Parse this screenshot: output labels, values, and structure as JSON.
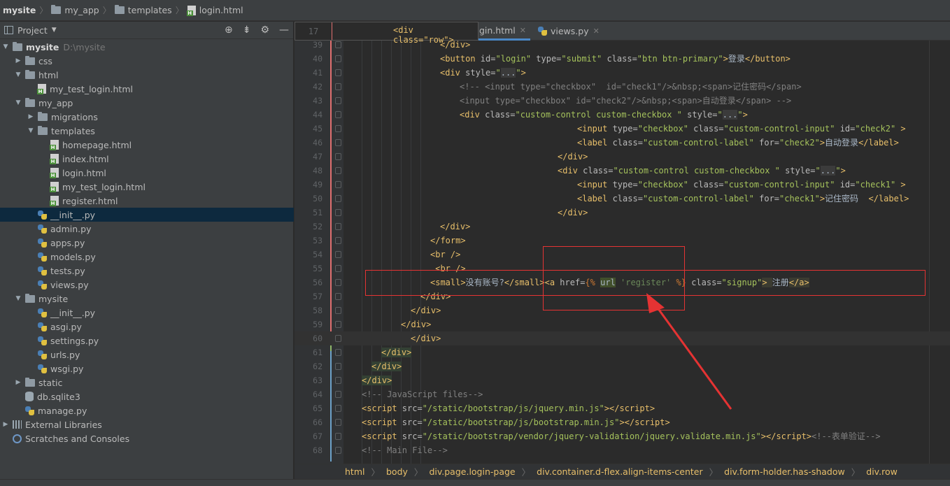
{
  "breadcrumb": {
    "items": [
      "mysite",
      "my_app",
      "templates",
      "login.html"
    ]
  },
  "project_panel": {
    "title": "Project",
    "tree": [
      {
        "label": "mysite",
        "hint": "D:\\mysite",
        "type": "folder",
        "level": 0,
        "expanded": true,
        "bold": true
      },
      {
        "label": "css",
        "type": "folder",
        "level": 1,
        "expanded": false
      },
      {
        "label": "html",
        "type": "folder",
        "level": 1,
        "expanded": true
      },
      {
        "label": "my_test_login.html",
        "type": "html",
        "level": 2
      },
      {
        "label": "my_app",
        "type": "folder",
        "level": 1,
        "expanded": true
      },
      {
        "label": "migrations",
        "type": "folder",
        "level": 2,
        "expanded": false
      },
      {
        "label": "templates",
        "type": "folder",
        "level": 2,
        "expanded": true
      },
      {
        "label": "homepage.html",
        "type": "html",
        "level": 3
      },
      {
        "label": "index.html",
        "type": "html",
        "level": 3
      },
      {
        "label": "login.html",
        "type": "html",
        "level": 3
      },
      {
        "label": "my_test_login.html",
        "type": "html",
        "level": 3
      },
      {
        "label": "register.html",
        "type": "html",
        "level": 3
      },
      {
        "label": "__init__.py",
        "type": "py",
        "level": 2,
        "selected": true
      },
      {
        "label": "admin.py",
        "type": "py",
        "level": 2
      },
      {
        "label": "apps.py",
        "type": "py",
        "level": 2
      },
      {
        "label": "models.py",
        "type": "py",
        "level": 2
      },
      {
        "label": "tests.py",
        "type": "py",
        "level": 2
      },
      {
        "label": "views.py",
        "type": "py",
        "level": 2
      },
      {
        "label": "mysite",
        "type": "folder",
        "level": 1,
        "expanded": true
      },
      {
        "label": "__init__.py",
        "type": "py",
        "level": 2
      },
      {
        "label": "asgi.py",
        "type": "py",
        "level": 2
      },
      {
        "label": "settings.py",
        "type": "py",
        "level": 2
      },
      {
        "label": "urls.py",
        "type": "py",
        "level": 2
      },
      {
        "label": "wsgi.py",
        "type": "py",
        "level": 2
      },
      {
        "label": "static",
        "type": "folder",
        "level": 1,
        "expanded": false
      },
      {
        "label": "db.sqlite3",
        "type": "db",
        "level": 1
      },
      {
        "label": "manage.py",
        "type": "py",
        "level": 1
      },
      {
        "label": "External Libraries",
        "type": "lib",
        "level": 0,
        "expanded": false
      },
      {
        "label": "Scratches and Consoles",
        "type": "scratch",
        "level": 0
      }
    ]
  },
  "tabs": [
    {
      "label": "login.html",
      "visible_text": "gin.html",
      "active": true
    },
    {
      "label": "views.py",
      "visible_text": "views.py",
      "active": false
    }
  ],
  "sticky_header": {
    "line": "17",
    "code": "<div class=\"row\">"
  },
  "code_lines": [
    {
      "n": "39",
      "html": "<span class=\"tg\">&lt;/div&gt;</span>",
      "indent": 112
    },
    {
      "n": "40",
      "html": "<span class=\"tg\">&lt;button </span><span class=\"at\">id=</span><span class=\"av\">\"login\"</span><span class=\"at\"> type=</span><span class=\"av\">\"submit\"</span><span class=\"at\"> class=</span><span class=\"av\">\"btn btn-primary\"</span><span class=\"tg\">&gt;</span><span class=\"tx\">登录</span><span class=\"tg\">&lt;/button&gt;</span>",
      "indent": 112
    },
    {
      "n": "41",
      "html": "<span class=\"tg\">&lt;div </span><span class=\"at\">style=</span><span class=\"av\">\"<span class=\"fold-ph\">...</span>\"</span><span class=\"tg\">&gt;</span>",
      "indent": 112
    },
    {
      "n": "42",
      "html": "<span class=\"cm\">&lt;!-- &lt;input type=\"checkbox\"  id=\"check1\"/&gt;&amp;nbsp;&lt;span&gt;记住密码&lt;/span&gt;</span>",
      "indent": 140
    },
    {
      "n": "43",
      "html": "<span class=\"cm\">&lt;input type=\"checkbox\" id=\"check2\"/&gt;&amp;nbsp;&lt;span&gt;自动登录&lt;/span&gt; --&gt;</span>",
      "indent": 140
    },
    {
      "n": "44",
      "html": "<span class=\"tg\">&lt;div </span><span class=\"at\">class=</span><span class=\"av\">\"custom-control custom-checkbox \"</span><span class=\"at\"> style=</span><span class=\"av\">\"<span class=\"fold-ph\">...</span>\"</span><span class=\"tg\">&gt;</span>",
      "indent": 140
    },
    {
      "n": "45",
      "html": "<span class=\"tg\">&lt;input </span><span class=\"at\">type=</span><span class=\"av\">\"checkbox\"</span><span class=\"at\"> class=</span><span class=\"av\">\"custom-control-input\"</span><span class=\"at\"> id=</span><span class=\"av\">\"check2\"</span><span class=\"tg\"> &gt;</span>",
      "indent": 308
    },
    {
      "n": "46",
      "html": "<span class=\"tg\">&lt;label </span><span class=\"at\">class=</span><span class=\"av\">\"custom-control-label\"</span><span class=\"at\"> for=</span><span class=\"av\">\"check2\"</span><span class=\"tg\">&gt;</span><span class=\"tx\">自动登录</span><span class=\"tg\">&lt;/label&gt;</span>",
      "indent": 308
    },
    {
      "n": "47",
      "html": "<span class=\"tg\">&lt;/div&gt;</span>",
      "indent": 280
    },
    {
      "n": "48",
      "html": "<span class=\"tg\">&lt;div </span><span class=\"at\">class=</span><span class=\"av\">\"custom-control custom-checkbox \"</span><span class=\"at\"> style=</span><span class=\"av\">\"<span class=\"fold-ph\">...</span>\"</span><span class=\"tg\">&gt;</span>",
      "indent": 280
    },
    {
      "n": "49",
      "html": "<span class=\"tg\">&lt;input </span><span class=\"at\">type=</span><span class=\"av\">\"checkbox\"</span><span class=\"at\"> class=</span><span class=\"av\">\"custom-control-input\"</span><span class=\"at\"> id=</span><span class=\"av\">\"check1\"</span><span class=\"tg\"> &gt;</span>",
      "indent": 308
    },
    {
      "n": "50",
      "html": "<span class=\"tg\">&lt;label </span><span class=\"at\">class=</span><span class=\"av\">\"custom-control-label\"</span><span class=\"at\"> for=</span><span class=\"av\">\"check1\"</span><span class=\"tg\">&gt;</span><span class=\"tx\">记住密码  </span><span class=\"tg\">&lt;/label&gt;</span>",
      "indent": 308
    },
    {
      "n": "51",
      "html": "<span class=\"tg\">&lt;/div&gt;</span>",
      "indent": 280
    },
    {
      "n": "52",
      "html": "<span class=\"tg\">&lt;/div&gt;</span>",
      "indent": 112
    },
    {
      "n": "53",
      "html": "<span class=\"tg\">&lt;/form&gt;</span>",
      "indent": 98
    },
    {
      "n": "54",
      "html": "<span class=\"tg\">&lt;br /&gt;</span>",
      "indent": 98
    },
    {
      "n": "55",
      "html": "<span class=\"tg\"> &lt;br /&gt;</span>",
      "indent": 98
    },
    {
      "n": "56",
      "html": "<span class=\"tg\">&lt;small&gt;</span><span class=\"tx\">没有账号?</span><span class=\"tg\">&lt;/small&gt;</span><span class=\"tg\">&lt;a </span><span class=\"at\">href=</span><span class=\"dj\">{% </span><span class=\"hl-url tx\">url</span><span class=\"djv\"> 'register'</span><span class=\"dj\"> %}</span><span class=\"at\"> class=</span><span class=\"av\">\"signup\"</span><span class=\"tg hl-a\">&gt; </span><span class=\"tx\">注册</span><span class=\"tg hl-a\">&lt;/a&gt;</span>",
      "indent": 98
    },
    {
      "n": "57",
      "html": "<span class=\"tg\">&lt;/div&gt;</span>",
      "indent": 84
    },
    {
      "n": "58",
      "html": "<span class=\"tg\">&lt;/div&gt;</span>",
      "indent": 70
    },
    {
      "n": "59",
      "html": "<span class=\"tg\">&lt;/div&gt;</span>",
      "indent": 56
    },
    {
      "n": "60",
      "html": "<span class=\"tg\">&lt;/div&gt;</span>",
      "indent": 70,
      "current": true
    },
    {
      "n": "61",
      "html": "<span class=\"tg hl-tag\">&lt;/div&gt;</span>",
      "indent": 28
    },
    {
      "n": "62",
      "html": "<span class=\"tg hl-tag\">&lt;/div&gt;</span>",
      "indent": 14
    },
    {
      "n": "63",
      "html": "<span class=\"tg hl-tag\">&lt;/div&gt;</span>",
      "indent": 0
    },
    {
      "n": "64",
      "html": "<span class=\"cm\">&lt;!-- JavaScript files--&gt;</span>",
      "indent": 0
    },
    {
      "n": "65",
      "html": "<span class=\"tg\">&lt;script </span><span class=\"at\">src=</span><span class=\"av\">\"/static/bootstrap/js/jquery.min.js\"</span><span class=\"tg\">&gt;&lt;/script&gt;</span>",
      "indent": 0
    },
    {
      "n": "66",
      "html": "<span class=\"tg\">&lt;script </span><span class=\"at\">src=</span><span class=\"av\">\"/static/bootstrap/js/bootstrap.min.js\"</span><span class=\"tg\">&gt;&lt;/script&gt;</span>",
      "indent": 0
    },
    {
      "n": "67",
      "html": "<span class=\"tg\">&lt;script </span><span class=\"at\">src=</span><span class=\"av\">\"/static/bootstrap/vendor/jquery-validation/jquery.validate.min.js\"</span><span class=\"tg\">&gt;&lt;/script&gt;</span><span class=\"cm\">&lt;!--表单验证--&gt;</span>",
      "indent": 0
    },
    {
      "n": "68",
      "html": "<span class=\"cm\">&lt;!-- Main File--&gt;</span>",
      "indent": 0
    }
  ],
  "editor_breadcrumb": [
    "html",
    "body",
    "div.page.login-page",
    "div.container.d-flex.align-items-center",
    "div.form-holder.has-shadow",
    "div.row"
  ],
  "colors": {
    "annotation": "#e53333",
    "tag": "#e8bf6a",
    "attr_value": "#a5c25c",
    "comment": "#808080"
  }
}
